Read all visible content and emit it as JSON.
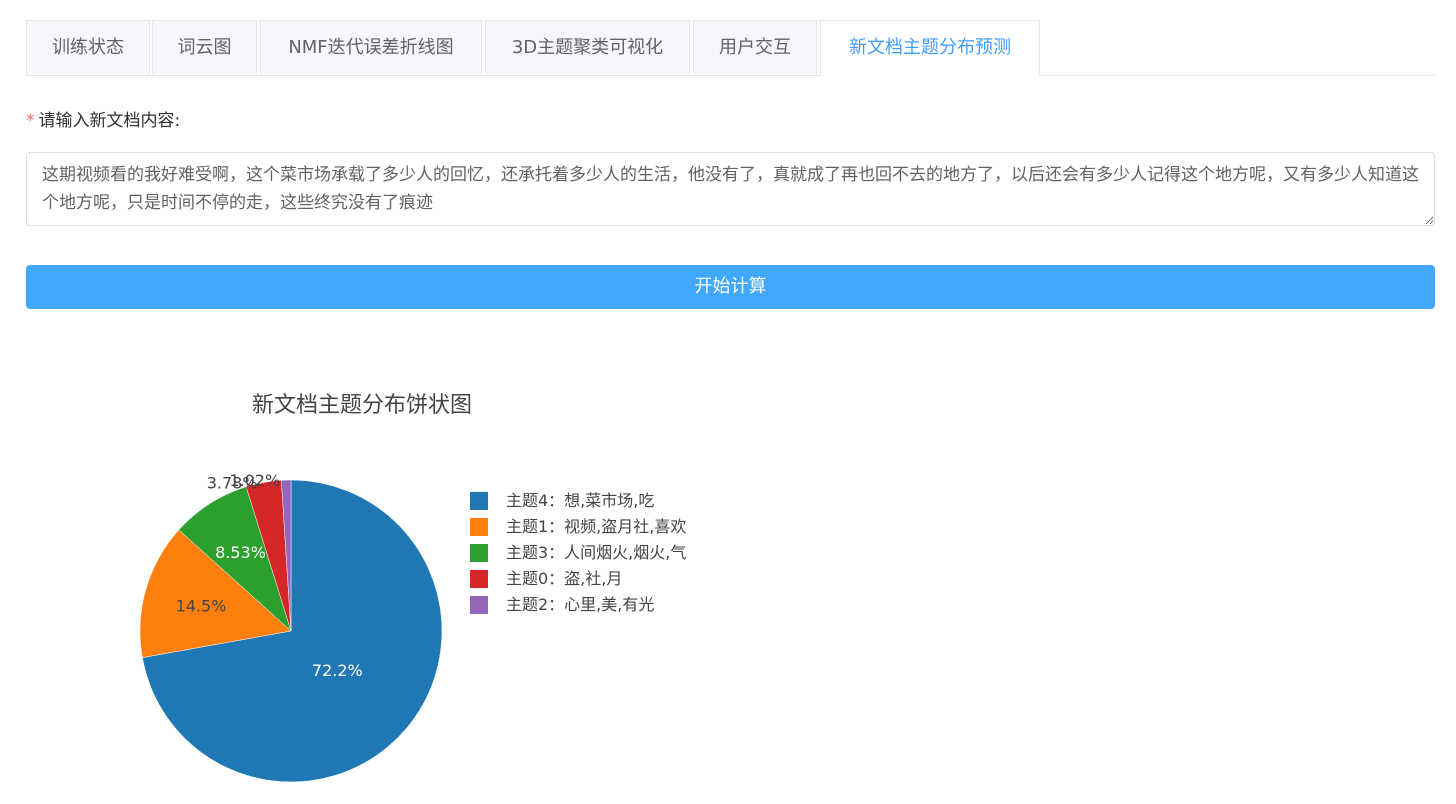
{
  "tabs": [
    {
      "label": "训练状态",
      "active": false
    },
    {
      "label": "词云图",
      "active": false
    },
    {
      "label": "NMF迭代误差折线图",
      "active": false
    },
    {
      "label": "3D主题聚类可视化",
      "active": false
    },
    {
      "label": "用户交互",
      "active": false
    },
    {
      "label": "新文档主题分布预测",
      "active": true
    }
  ],
  "form": {
    "required_mark": "*",
    "label": "请输入新文档内容:",
    "input_value": "这期视频看的我好难受啊，这个菜市场承载了多少人的回忆，还承托着多少人的生活，他没有了，真就成了再也回不去的地方了，以后还会有多少人记得这个地方呢，又有多少人知道这个地方呢，只是时间不停的走，这些终究没有了痕迹",
    "submit_label": "开始计算"
  },
  "colors": {
    "accent": "#409eff",
    "button": "#40a9ff",
    "required": "#f56c6c"
  },
  "chart_data": {
    "type": "pie",
    "title": "新文档主题分布饼状图",
    "series": [
      {
        "name": "主题4：想,菜市场,吃",
        "value": 72.2,
        "label": "72.2%",
        "color": "#1f77b4"
      },
      {
        "name": "主题1：视频,盗月社,喜欢",
        "value": 14.5,
        "label": "14.5%",
        "color": "#ff7f0e"
      },
      {
        "name": "主题3：人间烟火,烟火,气",
        "value": 8.53,
        "label": "8.53%",
        "color": "#2ca02c"
      },
      {
        "name": "主题0：盗,社,月",
        "value": 3.78,
        "label": "3.78%",
        "color": "#d62728"
      },
      {
        "name": "主题2：心里,美,有光",
        "value": 1.02,
        "label": "1.02%",
        "color": "#9467bd"
      }
    ],
    "legend_position": "right"
  }
}
